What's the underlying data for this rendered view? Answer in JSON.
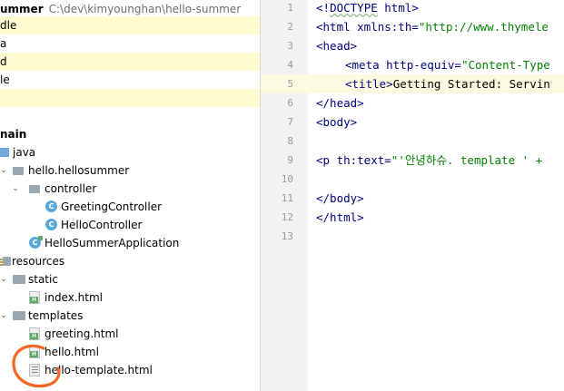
{
  "project": {
    "root_name": "ummer",
    "root_path": "C:\\dev\\kimyounghan\\hello-summer",
    "top_rows": [
      "dle",
      "a",
      "d",
      "le",
      ""
    ],
    "main_label": "nain",
    "java_label": "java",
    "package_label": "hello.hellosummer",
    "controller_label": "controller",
    "greeting_controller": "GreetingController",
    "hello_controller": "HelloController",
    "app_class": "HelloSummerApplication",
    "resources_label": "resources",
    "static_label": "static",
    "index_html": "index.html",
    "templates_label": "templates",
    "greeting_html": "greeting.html",
    "hello_html": "hello.html",
    "hello_template_html": "hello-template.html",
    "class_icon_glyph": "C"
  },
  "editor": {
    "line_numbers": [
      "1",
      "2",
      "3",
      "4",
      "5",
      "6",
      "7",
      "8",
      "9",
      "10",
      "11",
      "12",
      "13"
    ],
    "active_line": 5,
    "lines": {
      "l1": [
        "<!",
        "DOCTYPE",
        " html>"
      ],
      "l2": [
        "<html ",
        "xmlns:th",
        "=",
        "\"http://www.thymele"
      ],
      "l3": "<head>",
      "l4": [
        "<meta ",
        "http-equiv",
        "=",
        "\"Content-Type"
      ],
      "l5": [
        "<title>",
        "Getting Started: Servin"
      ],
      "l6": "</head>",
      "l7": "<body>",
      "l8": "",
      "l9": [
        "<p ",
        "th:text",
        "=",
        "\"'안녕하슈. template ' +"
      ],
      "l10": "",
      "l11": "</body>",
      "l12": "</html>",
      "l13": ""
    }
  },
  "colors": {
    "highlight_row": "#fffbd1",
    "active_line": "#fcfae0",
    "tag": "#000080",
    "string": "#008000",
    "annotation_circle": "#f26522"
  }
}
